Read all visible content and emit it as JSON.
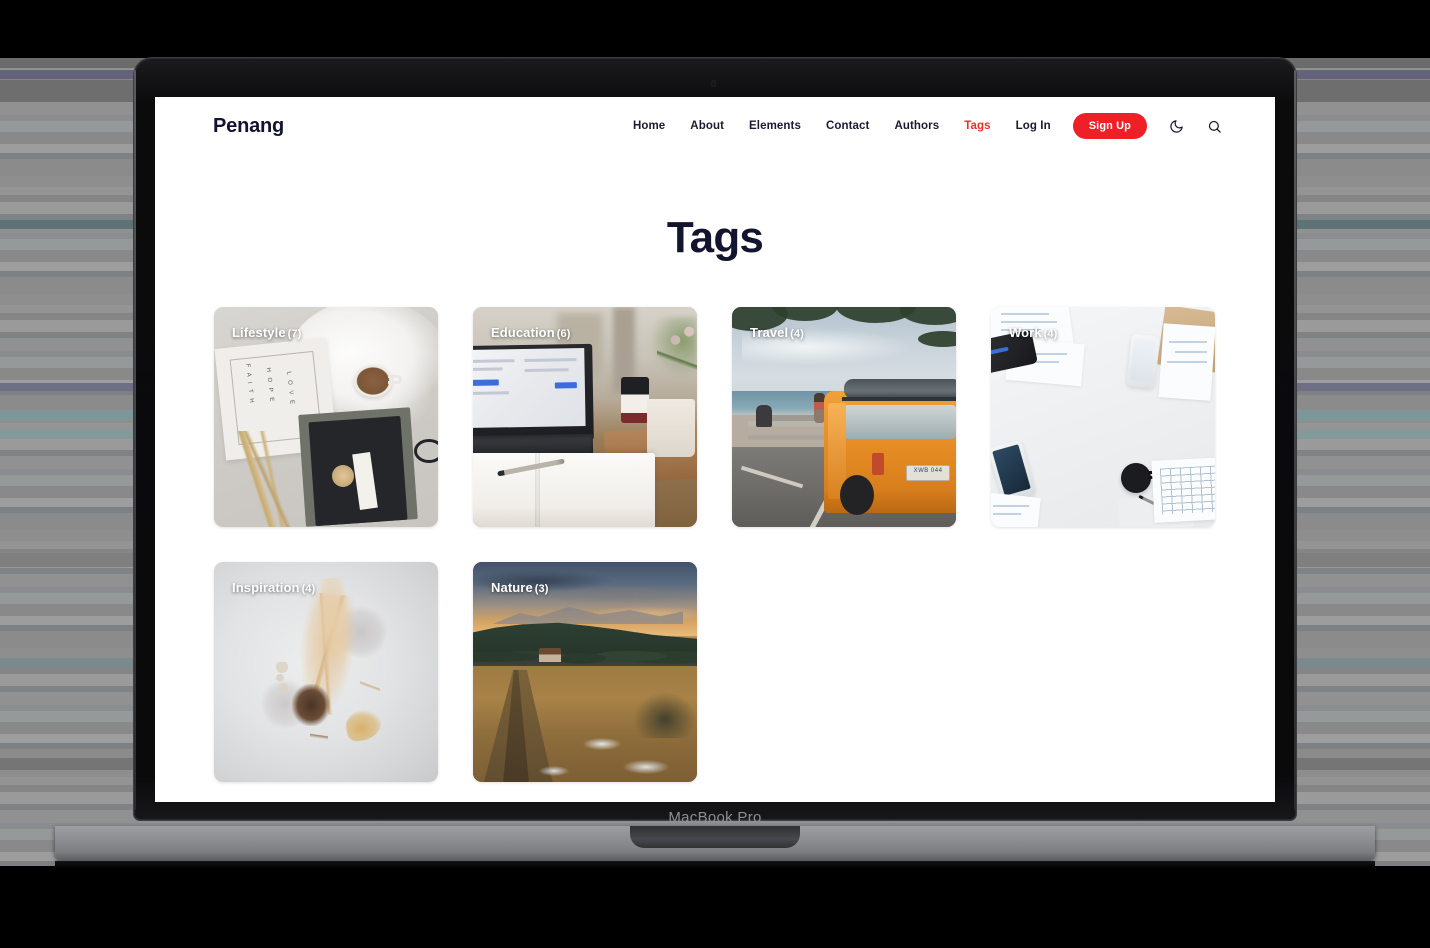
{
  "device": {
    "model_label": "MacBook Pro"
  },
  "site": {
    "brand": "Penang",
    "nav": {
      "links": [
        {
          "label": "Home",
          "active": false
        },
        {
          "label": "About",
          "active": false
        },
        {
          "label": "Elements",
          "active": false
        },
        {
          "label": "Contact",
          "active": false
        },
        {
          "label": "Authors",
          "active": false
        },
        {
          "label": "Tags",
          "active": true
        },
        {
          "label": "Log In",
          "active": false
        }
      ],
      "signup_label": "Sign Up",
      "dark_mode_icon": "moon-icon",
      "search_icon": "search-icon",
      "accent_color": "#ef1f28",
      "active_link_color": "#f02d2d"
    },
    "page_title": "Tags",
    "tags": [
      {
        "name": "Lifestyle",
        "count": "(7)",
        "image": "flat-lay-faith-hope-love-card-coffee-notebooks"
      },
      {
        "name": "Education",
        "count": "(6)",
        "image": "laptop-open-notebook-pen-coffee-on-desk"
      },
      {
        "name": "Travel",
        "count": "(4)",
        "image": "orange-vw-van-at-beach-parking-lot"
      },
      {
        "name": "Work",
        "count": "(4)",
        "image": "white-desk-with-phones-papers-and-mug"
      },
      {
        "name": "Inspiration",
        "count": "(4)",
        "image": "dried-botanical-arrangement-on-grey"
      },
      {
        "name": "Nature",
        "count": "(3)",
        "image": "sunset-mountain-meadow-with-forest"
      }
    ]
  },
  "travel_card": {
    "license_plate": "XWB 044"
  },
  "lifestyle_card": {
    "words": [
      "F A I T H",
      "H O P E",
      "L O V E"
    ]
  }
}
